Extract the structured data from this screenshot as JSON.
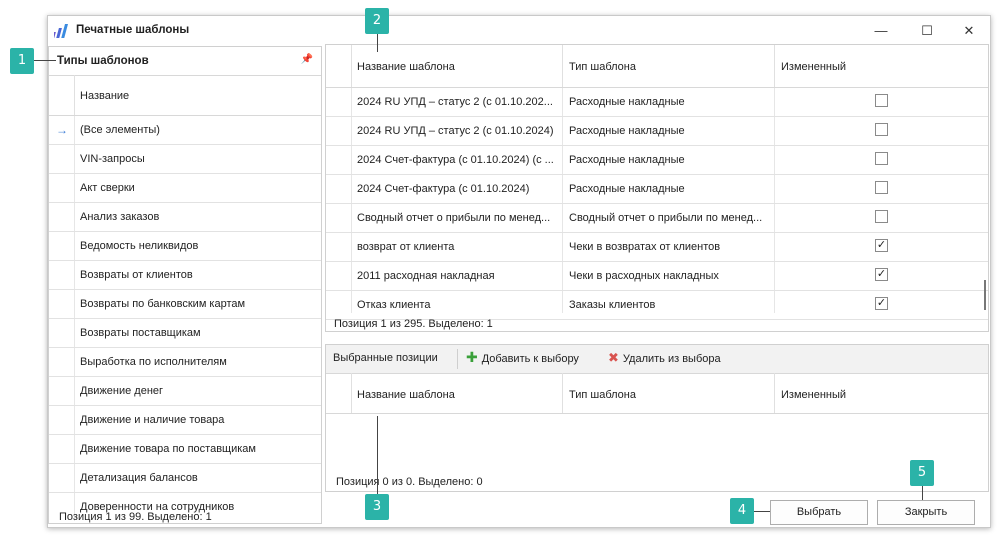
{
  "window": {
    "title": "Печатные шаблоны"
  },
  "left_panel": {
    "title": "Типы шаблонов",
    "column_header": "Название",
    "items": [
      "(Все элементы)",
      "VIN-запросы",
      "Акт сверки",
      "Анализ заказов",
      "Ведомость неликвидов",
      "Возвраты от клиентов",
      "Возвраты по банковским картам",
      "Возвраты поставщикам",
      "Выработка по исполнителям",
      "Движение денег",
      "Движение и наличие товара",
      "Движение товара по поставщикам",
      "Детализация балансов",
      "Доверенности на сотрудников"
    ],
    "footer": "Позиция 1 из 99. Выделено: 1"
  },
  "templates_grid": {
    "columns": [
      "Название шаблона",
      "Тип шаблона",
      "Измененный"
    ],
    "rows": [
      {
        "name": "2024 RU УПД – статус 2 (с 01.10.202...",
        "type": "Расходные накладные",
        "changed": ""
      },
      {
        "name": "2024 RU УПД – статус 2 (с 01.10.2024)",
        "type": "Расходные накладные",
        "changed": ""
      },
      {
        "name": "2024 Счет-фактура (с 01.10.2024) (с ...",
        "type": "Расходные накладные",
        "changed": ""
      },
      {
        "name": "2024 Счет-фактура (с 01.10.2024)",
        "type": "Расходные накладные",
        "changed": ""
      },
      {
        "name": "Сводный отчет о прибыли по менед...",
        "type": "Сводный отчет о прибыли по менед...",
        "changed": ""
      },
      {
        "name": "возврат от клиента",
        "type": "Чеки в возвратах от клиентов",
        "changed": "✓"
      },
      {
        "name": "2011 расходная накладная",
        "type": "Чеки в расходных накладных",
        "changed": "✓"
      },
      {
        "name": "Отказ клиента",
        "type": "Заказы клиентов",
        "changed": "✓"
      }
    ],
    "footer": "Позиция 1 из 295. Выделено: 1"
  },
  "selected_panel": {
    "tab": "Выбранные позиции",
    "add_label": "Добавить к выбору",
    "remove_label": "Удалить из выбора",
    "columns": [
      "Название шаблона",
      "Тип шаблона",
      "Измененный"
    ],
    "footer": "Позиция 0 из 0. Выделено: 0"
  },
  "buttons": {
    "select": "Выбрать",
    "close": "Закрыть"
  },
  "window_controls": {
    "minimize": "—",
    "maximize": "☐",
    "close": "✕"
  },
  "callouts": [
    "1",
    "2",
    "3",
    "4",
    "5"
  ],
  "colors": {
    "callout": "#2bb3a8",
    "add_icon": "#3aa03a",
    "remove_icon": "#d9534f",
    "current_row_arrow": "#3a7bd5"
  }
}
